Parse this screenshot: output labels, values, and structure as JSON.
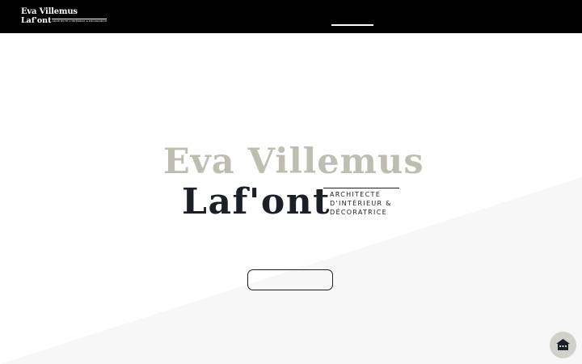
{
  "header": {
    "logo": {
      "line1": "Eva Villemus",
      "line2": "Laf'ont",
      "tagline_small": "ARCHITECTE D'INTÉRIEUR & DÉCORATRICE"
    },
    "active_nav_indicator": true
  },
  "hero": {
    "name_line1": "Eva Villemus",
    "name_line2": "Laf'ont",
    "tagline": [
      "ARCHITECTE",
      "D'INTÉRIEUR &",
      "DÉCORATRICE"
    ],
    "cta_label": ""
  },
  "chat_widget": {
    "icon": "house-icon"
  },
  "colors": {
    "header_bg": "#000000",
    "name_light": "#bfbcb2",
    "name_dark": "#1b1f26",
    "background": "#ffffff",
    "diagonal_shade": "#f7f7f7",
    "chat_bubble": "#d2d0cb"
  }
}
